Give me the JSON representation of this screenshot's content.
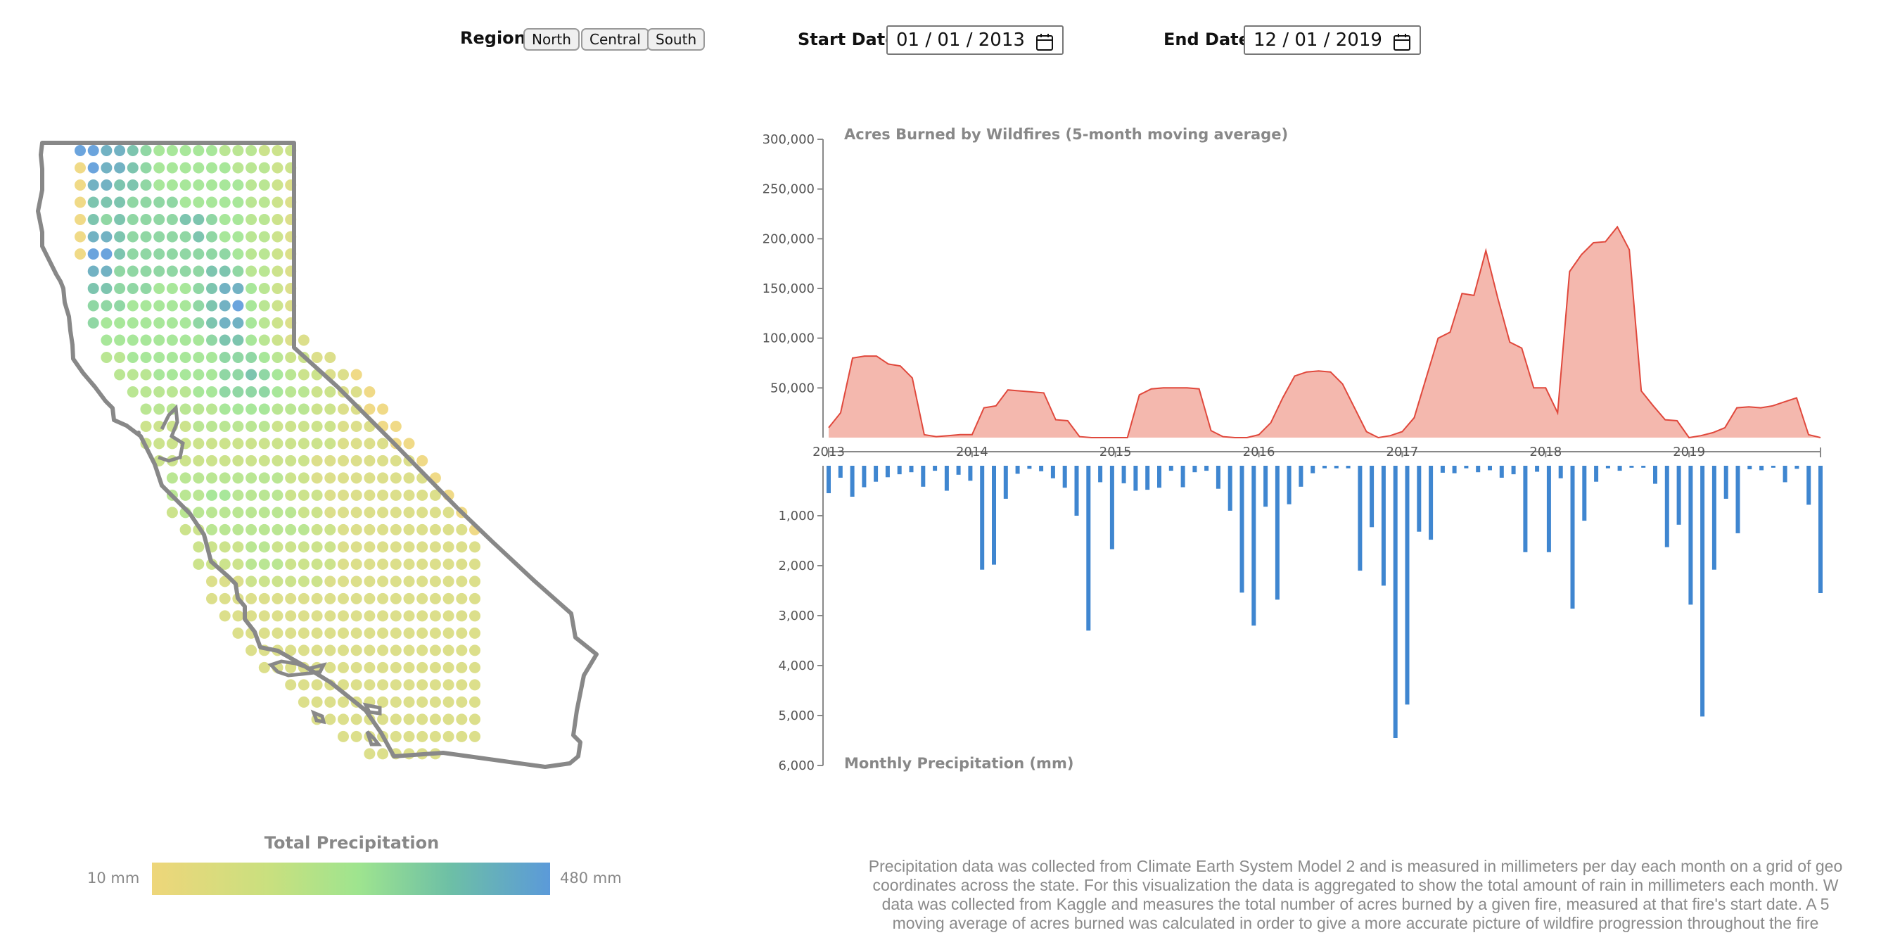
{
  "controls": {
    "region_label": "Region:",
    "region_buttons": [
      "North",
      "Central",
      "South"
    ],
    "start_label": "Start Date:",
    "start_value": "01 / 01 / 2013",
    "end_label": "End Date:",
    "end_value": "12 / 01 / 2019"
  },
  "legend": {
    "title": "Total Precipitation",
    "min_label": "10 mm",
    "max_label": "480 mm",
    "colors": [
      "#eed67a",
      "#c8e07f",
      "#9ee48f",
      "#6dbfa6",
      "#5b9ad9"
    ]
  },
  "footnote": {
    "lines": [
      "Precipitation data was collected from Climate Earth System Model 2 and is measured in millimeters per day each month on a grid of geo",
      "coordinates across the state. For this visualization the data is aggregated to show the total amount of rain in millimeters each month. W",
      "data was collected from Kaggle and measures the total number of acres burned by a given fire, measured at that fire's start date. A 5",
      "moving average of acres burned was calculated in order to give a more accurate picture of wildfire progression throughout the fire"
    ]
  },
  "chart_data": [
    {
      "type": "area",
      "title": "Acres Burned by Wildfires (5-month moving average)",
      "x_start": "2013-01",
      "x_end": "2019-12",
      "x_ticks": [
        "2013",
        "2014",
        "2015",
        "2016",
        "2017",
        "2018",
        "2019"
      ],
      "y_ticks": [
        "50,000",
        "100,000",
        "150,000",
        "200,000",
        "250,000",
        "300,000"
      ],
      "ylim": [
        0,
        300000
      ],
      "color": "#f4b8ae",
      "stroke": "#e0483c",
      "values": [
        10000,
        25000,
        80000,
        82000,
        82000,
        74000,
        72000,
        60000,
        3000,
        1000,
        2000,
        3000,
        3000,
        30000,
        32000,
        48000,
        47000,
        46000,
        45000,
        18000,
        17000,
        1000,
        0,
        0,
        0,
        0,
        43000,
        49000,
        50000,
        50000,
        50000,
        49000,
        7000,
        1000,
        0,
        0,
        3000,
        15000,
        40000,
        62000,
        66000,
        67000,
        66000,
        54000,
        30000,
        6000,
        0,
        2000,
        6000,
        20000,
        60000,
        100000,
        106000,
        145000,
        143000,
        188000,
        140000,
        96000,
        90000,
        50000,
        50000,
        25000,
        167000,
        184000,
        196000,
        197000,
        212000,
        189000,
        47000,
        32000,
        18000,
        17000,
        0,
        2000,
        5000,
        10000,
        30000,
        31000,
        30000,
        32000,
        36000,
        40000,
        3000,
        0
      ]
    },
    {
      "type": "bar",
      "title": "Monthly Precipitation (mm)",
      "x_start": "2013-01",
      "x_end": "2019-12",
      "y_ticks": [
        "1,000",
        "2,000",
        "3,000",
        "4,000",
        "5,000",
        "6,000"
      ],
      "ylim": [
        0,
        6000
      ],
      "color": "#3f86d0",
      "values": [
        550,
        240,
        620,
        430,
        320,
        230,
        170,
        130,
        420,
        100,
        500,
        180,
        300,
        2080,
        1980,
        660,
        160,
        60,
        110,
        250,
        440,
        1000,
        3300,
        330,
        1670,
        350,
        500,
        480,
        440,
        100,
        430,
        130,
        100,
        460,
        900,
        2540,
        3200,
        820,
        2680,
        770,
        420,
        150,
        50,
        50,
        50,
        2100,
        1230,
        2400,
        5450,
        4780,
        1320,
        1480,
        140,
        150,
        50,
        130,
        90,
        240,
        170,
        1730,
        120,
        1730,
        250,
        2860,
        1100,
        320,
        50,
        100,
        40,
        40,
        360,
        1630,
        1180,
        2780,
        5020,
        2080,
        660,
        1350,
        70,
        90,
        40,
        330,
        60,
        780,
        2550
      ]
    },
    {
      "type": "heatmap",
      "title": "",
      "rows": 36,
      "cols": 31,
      "mask": [
        "1111111111111111100000000000000",
        "1111111111111111100000000000000",
        "1111111111111111100000000000000",
        "1111111111111111100000000000000",
        "1111111111111111100000000000000",
        "1111111111111111100000000000000",
        "1111111111111111100000000000000",
        "0111111111111111100000000000000",
        "0111111111111111100000000000000",
        "0111111111111111100000000000000",
        "0111111111111111100000000000000",
        "0011111111111111110000000000000",
        "0011111111111111111100000000000",
        "0001111111111111111111000000000",
        "0000111111111111111111100000000",
        "0000011111111111111111110000000",
        "0000011111111111111111111000000",
        "0000011111111111111111111100000",
        "0000001111111111111111111110000",
        "0000000111111111111111111111000",
        "0000000111111111111111111111100",
        "0000000111111111111111111111110",
        "0000000011111111111111111111111",
        "0000000001111111111111111111111",
        "0000000001111111111111111111111",
        "0000000000111111111111111111111",
        "0000000000111111111111111111111",
        "0000000000011111111111111111111",
        "0000000000001111111111111111111",
        "0000000000000111111111111111111",
        "0000000000000011111111111111111",
        "0000000000000000111111111111111",
        "0000000000000000011111111111111",
        "0000000000000000001111111111111",
        "0000000000000000000011111111111",
        "0000000000000000000000111111000"
      ],
      "palette": [
        "#eed67a",
        "#d8dc7e",
        "#c6e080",
        "#b3e387",
        "#9ee48f",
        "#84d39a",
        "#6fbfa6",
        "#63aabc",
        "#5b9ad9"
      ],
      "levels": [
        "8877654444433322200000000000000",
        "0877654444443332200000000000000",
        "0776654444444332100000000000000",
        "0666555544444332100000000000000",
        "0656555566544332100000000000000",
        "0776555556544332100000000000000",
        "0886555555554332100000000000000",
        "0775555555665332100000000000000",
        "0665554445677432100000000000000",
        "0555444445678432100000000000000",
        "0544444445677432100000000000000",
        "0044444444566432110000000000000",
        "0033444444455543221100000000000",
        "0003334444455654322110000000000",
        "0000333334455554332211000000000",
        "0000033333344443332211000000000",
        "0000022223333332222211100000000",
        "0000022222222222222211110000000",
        "0000002222222222221111111100000",
        "0000000333333333221111111110000",
        "0000000333443333222111111111000",
        "0000000233333333322111111111100",
        "0000000022333333332211111111110",
        "0000000002222332222211111111111",
        "0000000002222333222211111111111",
        "0000000000111222222111111111111",
        "0000000000111111111111111111111",
        "0000000000011111111111111111111",
        "0000000000001111111111111111111",
        "0000000000000111111111111111111",
        "0000000000000011111111111111111",
        "0000000000000000111111111111111",
        "0000000000000000011111111111111",
        "0000000000000000001111111111111",
        "0000000000000000000011111111111",
        "0000000000000000000000111111000"
      ]
    }
  ]
}
